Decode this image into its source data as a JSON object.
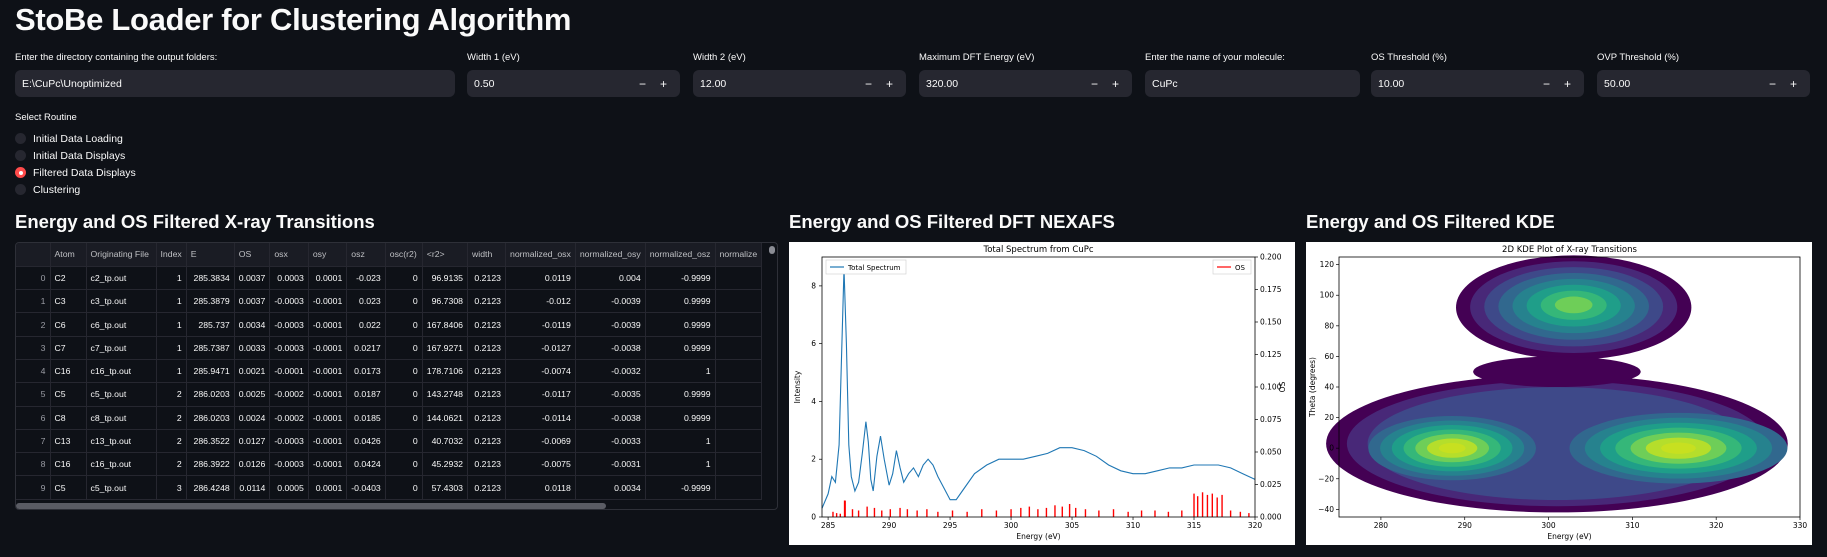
{
  "app": {
    "title": "StoBe Loader for Clustering Algorithm"
  },
  "inputs": {
    "directory": {
      "label": "Enter the directory containing the output folders:",
      "value": "E:\\CuPc\\Unoptimized"
    },
    "width1": {
      "label": "Width 1 (eV)",
      "value": "0.50"
    },
    "width2": {
      "label": "Width 2 (eV)",
      "value": "12.00"
    },
    "max_energy": {
      "label": "Maximum DFT Energy (eV)",
      "value": "320.00"
    },
    "molecule": {
      "label": "Enter the name of your molecule:",
      "value": "CuPc"
    },
    "os_threshold": {
      "label": "OS Threshold (%)",
      "value": "10.00"
    },
    "ovp_threshold": {
      "label": "OVP Threshold (%)",
      "value": "50.00"
    },
    "minus": "−",
    "plus": "+"
  },
  "routine": {
    "label": "Select Routine",
    "options": [
      "Initial Data Loading",
      "Initial Data Displays",
      "Filtered Data Displays",
      "Clustering"
    ],
    "selected": 2
  },
  "sections": {
    "table_title": "Energy and OS Filtered X-ray Transitions",
    "nexafs_title": "Energy and OS Filtered DFT NEXAFS",
    "kde_title": "Energy and OS Filtered KDE"
  },
  "table": {
    "columns": [
      "",
      "Atom",
      "Originating File",
      "Index",
      "E",
      "OS",
      "osx",
      "osy",
      "osz",
      "osc(r2)",
      "<r2>",
      "width",
      "normalized_osx",
      "normalized_osy",
      "normalized_osz",
      "normalize"
    ],
    "rows": [
      [
        "0",
        "C2",
        "c2_tp.out",
        "1",
        "285.3834",
        "0.0037",
        "0.0003",
        "0.0001",
        "-0.023",
        "0",
        "96.9135",
        "0.2123",
        "0.0119",
        "0.004",
        "-0.9999",
        ""
      ],
      [
        "1",
        "C3",
        "c3_tp.out",
        "1",
        "285.3879",
        "0.0037",
        "-0.0003",
        "-0.0001",
        "0.023",
        "0",
        "96.7308",
        "0.2123",
        "-0.012",
        "-0.0039",
        "0.9999",
        ""
      ],
      [
        "2",
        "C6",
        "c6_tp.out",
        "1",
        "285.737",
        "0.0034",
        "-0.0003",
        "-0.0001",
        "0.022",
        "0",
        "167.8406",
        "0.2123",
        "-0.0119",
        "-0.0039",
        "0.9999",
        ""
      ],
      [
        "3",
        "C7",
        "c7_tp.out",
        "1",
        "285.7387",
        "0.0033",
        "-0.0003",
        "-0.0001",
        "0.0217",
        "0",
        "167.9271",
        "0.2123",
        "-0.0127",
        "-0.0038",
        "0.9999",
        ""
      ],
      [
        "4",
        "C16",
        "c16_tp.out",
        "1",
        "285.9471",
        "0.0021",
        "-0.0001",
        "-0.0001",
        "0.0173",
        "0",
        "178.7106",
        "0.2123",
        "-0.0074",
        "-0.0032",
        "1",
        ""
      ],
      [
        "5",
        "C5",
        "c5_tp.out",
        "2",
        "286.0203",
        "0.0025",
        "-0.0002",
        "-0.0001",
        "0.0187",
        "0",
        "143.2748",
        "0.2123",
        "-0.0117",
        "-0.0035",
        "0.9999",
        ""
      ],
      [
        "6",
        "C8",
        "c8_tp.out",
        "2",
        "286.0203",
        "0.0024",
        "-0.0002",
        "-0.0001",
        "0.0185",
        "0",
        "144.0621",
        "0.2123",
        "-0.0114",
        "-0.0038",
        "0.9999",
        ""
      ],
      [
        "7",
        "C13",
        "c13_tp.out",
        "2",
        "286.3522",
        "0.0127",
        "-0.0003",
        "-0.0001",
        "0.0426",
        "0",
        "40.7032",
        "0.2123",
        "-0.0069",
        "-0.0033",
        "1",
        ""
      ],
      [
        "8",
        "C16",
        "c16_tp.out",
        "2",
        "286.3922",
        "0.0126",
        "-0.0003",
        "-0.0001",
        "0.0424",
        "0",
        "45.2932",
        "0.2123",
        "-0.0075",
        "-0.0031",
        "1",
        ""
      ],
      [
        "9",
        "C5",
        "c5_tp.out",
        "3",
        "286.4248",
        "0.0114",
        "0.0005",
        "0.0001",
        "-0.0403",
        "0",
        "57.4303",
        "0.2123",
        "0.0118",
        "0.0034",
        "-0.9999",
        ""
      ]
    ]
  },
  "chart_data": [
    {
      "type": "line",
      "title": "Total Spectrum from CuPc",
      "xlabel": "Energy (eV)",
      "ylabel": "Intensity",
      "y2label": "OS",
      "xlim": [
        284.5,
        320
      ],
      "ylim": [
        0,
        9
      ],
      "y2lim": [
        0,
        0.2
      ],
      "xticks": [
        285,
        290,
        295,
        300,
        305,
        310,
        315,
        320
      ],
      "yticks": [
        0,
        2,
        4,
        6,
        8
      ],
      "y2ticks": [
        "0.000",
        "0.025",
        "0.050",
        "0.075",
        "0.100",
        "0.125",
        "0.150",
        "0.175",
        "0.200"
      ],
      "legend": [
        "Total Spectrum",
        "OS"
      ],
      "series_colors": {
        "spectrum": "#1f77b4",
        "os": "#ff0000"
      },
      "x": [
        284.5,
        285.0,
        285.3,
        285.6,
        285.9,
        286.1,
        286.3,
        286.5,
        286.7,
        286.9,
        287.2,
        287.5,
        287.8,
        288.1,
        288.3,
        288.5,
        288.7,
        289.0,
        289.3,
        289.6,
        290.0,
        290.3,
        290.6,
        290.9,
        291.2,
        291.6,
        292.0,
        292.4,
        292.8,
        293.2,
        293.6,
        294.0,
        294.5,
        295.0,
        295.5,
        296.0,
        297.0,
        298.0,
        299.0,
        300.0,
        301.0,
        302.0,
        303.0,
        304.0,
        305.0,
        306.0,
        307.0,
        308.0,
        309.0,
        310.0,
        311.0,
        312.0,
        313.0,
        314.0,
        315.0,
        316.0,
        317.0,
        318.0,
        319.0,
        320.0
      ],
      "y": [
        0.3,
        0.8,
        1.4,
        1.2,
        2.5,
        5.5,
        8.6,
        6.0,
        2.5,
        1.4,
        0.9,
        1.2,
        2.2,
        3.3,
        2.6,
        1.3,
        0.9,
        2.1,
        2.8,
        2.0,
        1.1,
        1.5,
        2.3,
        1.7,
        1.2,
        1.5,
        1.7,
        1.4,
        1.8,
        2.0,
        1.8,
        1.4,
        1.0,
        0.6,
        0.6,
        0.9,
        1.5,
        1.8,
        2.0,
        2.0,
        2.0,
        2.1,
        2.2,
        2.4,
        2.4,
        2.3,
        2.1,
        1.8,
        1.6,
        1.5,
        1.5,
        1.6,
        1.7,
        1.7,
        1.8,
        1.8,
        1.8,
        1.7,
        1.5,
        1.3
      ],
      "os_x": [
        285.4,
        285.7,
        286.0,
        286.35,
        286.4,
        287.0,
        287.5,
        288.2,
        288.8,
        289.4,
        290.1,
        290.9,
        291.5,
        292.3,
        293.1,
        294.0,
        295.2,
        296.4,
        297.6,
        298.8,
        300.0,
        300.8,
        301.5,
        302.2,
        302.9,
        303.6,
        304.2,
        304.8,
        305.3,
        306.1,
        307.2,
        308.4,
        309.6,
        310.7,
        311.8,
        312.9,
        314.0,
        315.0,
        315.3,
        315.7,
        316.1,
        316.5,
        316.9,
        317.3,
        318.0,
        318.8,
        319.5
      ],
      "os_y": [
        0.004,
        0.003,
        0.0025,
        0.0127,
        0.0126,
        0.006,
        0.005,
        0.008,
        0.007,
        0.005,
        0.006,
        0.007,
        0.006,
        0.005,
        0.006,
        0.004,
        0.005,
        0.004,
        0.006,
        0.005,
        0.006,
        0.007,
        0.008,
        0.006,
        0.007,
        0.009,
        0.008,
        0.01,
        0.007,
        0.006,
        0.005,
        0.006,
        0.004,
        0.005,
        0.005,
        0.004,
        0.005,
        0.018,
        0.016,
        0.019,
        0.017,
        0.018,
        0.015,
        0.017,
        0.005,
        0.004,
        0.003
      ]
    },
    {
      "type": "heatmap",
      "title": "2D KDE Plot of X-ray Transitions",
      "xlabel": "Energy (eV)",
      "ylabel": "Theta (degrees)",
      "xlim": [
        275,
        330
      ],
      "ylim": [
        -45,
        125
      ],
      "xticks": [
        280,
        290,
        300,
        310,
        320,
        330
      ],
      "yticks": [
        -40,
        -20,
        0,
        20,
        40,
        60,
        80,
        100,
        120
      ],
      "colormap": [
        "#440154",
        "#482878",
        "#3e4989",
        "#31688e",
        "#26828e",
        "#1f9e89",
        "#35b779",
        "#6ece58",
        "#b5de2b",
        "#c7e020"
      ]
    }
  ]
}
